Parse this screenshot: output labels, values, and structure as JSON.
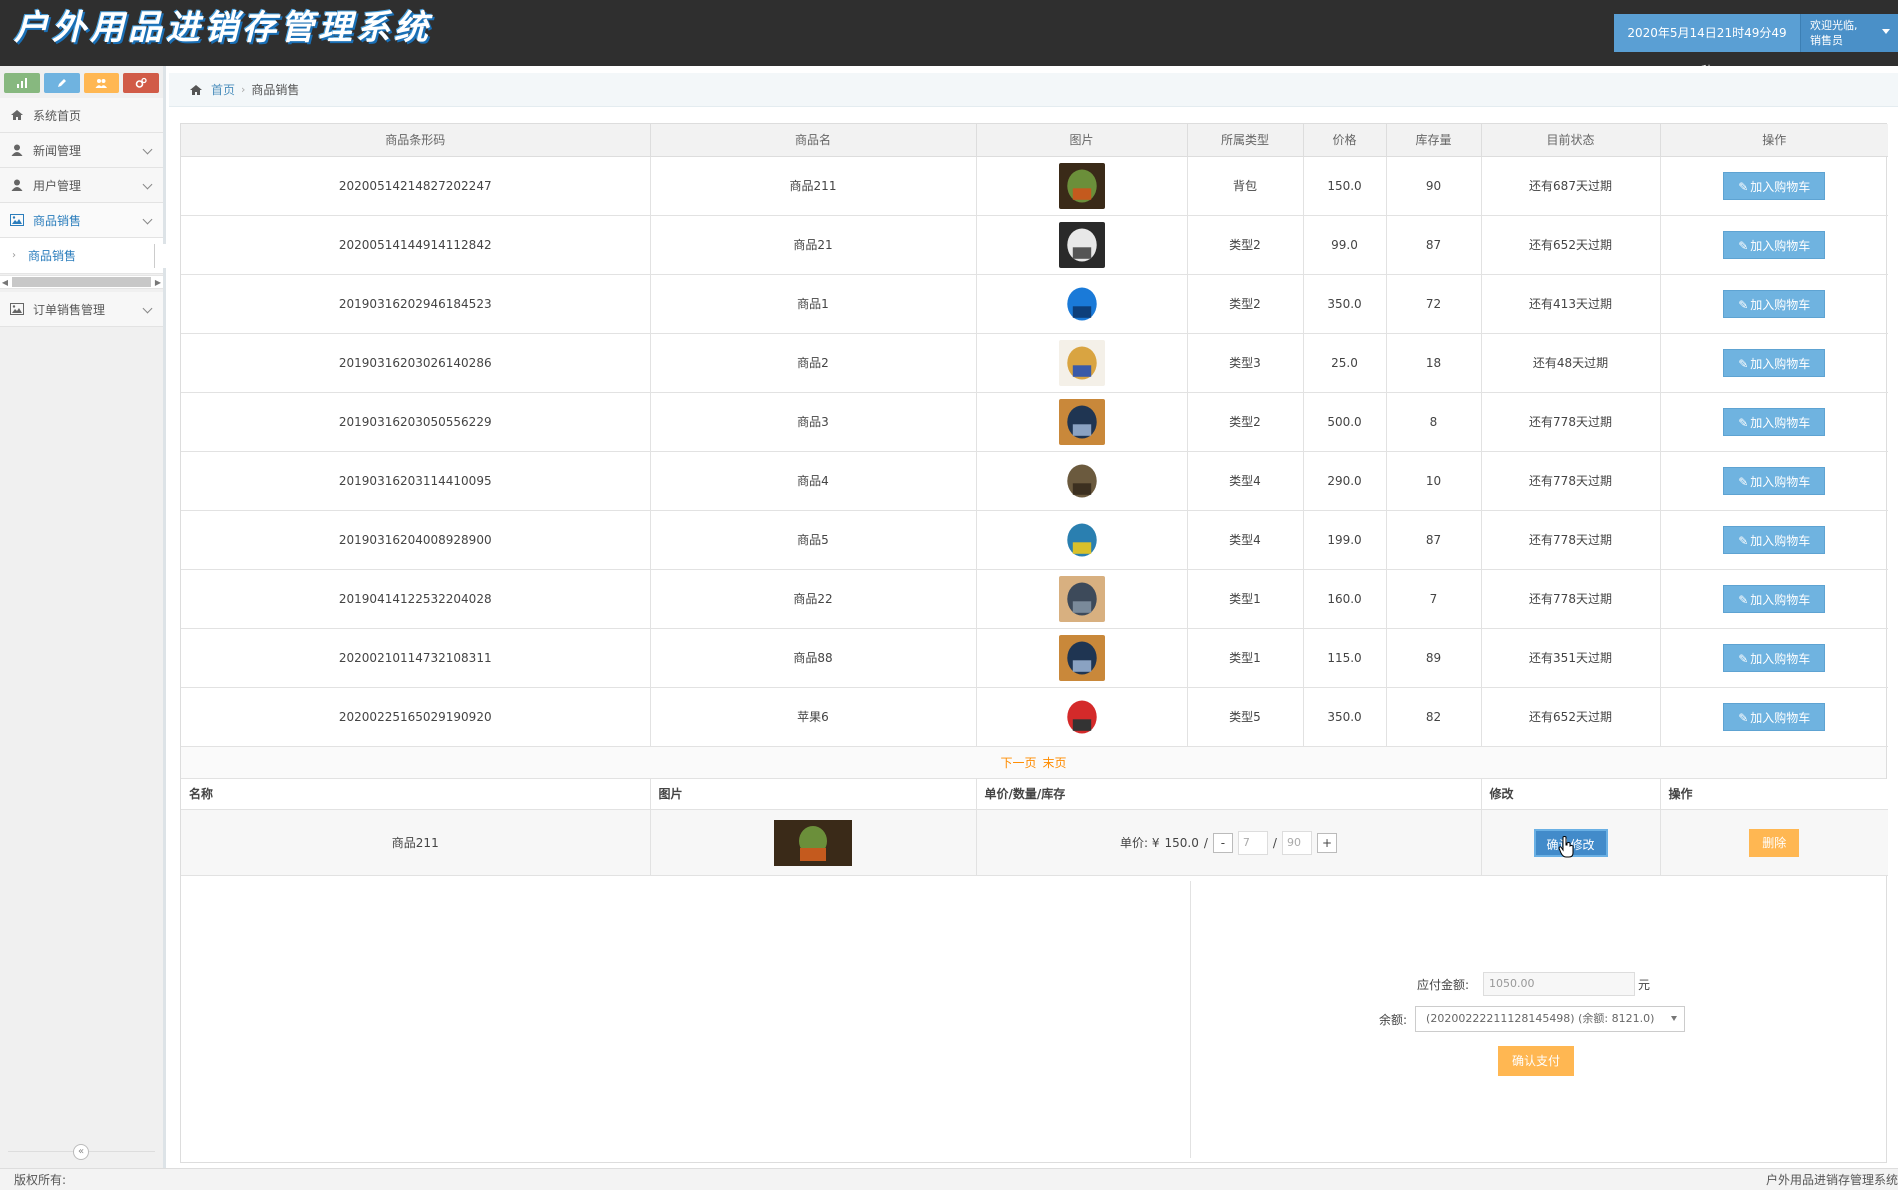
{
  "header": {
    "app_title": "户外用品进销存管理系统",
    "datetime": "2020年5月14日21时49分49秒",
    "welcome_line1": "欢迎光临,",
    "welcome_line2": "销售员"
  },
  "sidebar": {
    "shortcuts": [
      {
        "name": "chart-icon",
        "color": "#87b87f"
      },
      {
        "name": "pencil-icon",
        "color": "#6fb3e0"
      },
      {
        "name": "users-icon",
        "color": "#ffb752"
      },
      {
        "name": "cogs-icon",
        "color": "#d15b47"
      }
    ],
    "items": [
      {
        "label": "系统首页",
        "icon": "home-icon"
      },
      {
        "label": "新闻管理",
        "icon": "user-icon"
      },
      {
        "label": "用户管理",
        "icon": "user-icon"
      },
      {
        "label": "商品销售",
        "icon": "picture-icon"
      },
      {
        "label": "订单销售管理",
        "icon": "picture-icon"
      }
    ],
    "sub_item": "商品销售",
    "collapse_symbol": "«"
  },
  "breadcrumb": {
    "home": "首页",
    "current": "商品销售",
    "separator": "›"
  },
  "goods_table": {
    "headers": [
      "商品条形码",
      "商品名",
      "图片",
      "所属类型",
      "价格",
      "库存量",
      "目前状态",
      "操作"
    ],
    "action_label": "加入购物车",
    "rows": [
      {
        "barcode": "20200514214827202247",
        "name": "商品211",
        "type": "背包",
        "price": "150.0",
        "stock": "90",
        "status": "还有687天过期",
        "img": [
          "#3a2a18",
          "#6b8f3a",
          "#c45a1e"
        ]
      },
      {
        "barcode": "20200514144914112842",
        "name": "商品21",
        "type": "类型2",
        "price": "99.0",
        "stock": "87",
        "status": "还有652天过期",
        "img": [
          "#2a2a2a",
          "#e8e8e8",
          "#555555"
        ]
      },
      {
        "barcode": "20190316202946184523",
        "name": "商品1",
        "type": "类型2",
        "price": "350.0",
        "stock": "72",
        "status": "还有413天过期",
        "img": [
          "#ffffff",
          "#1a7ad8",
          "#0d3f7a"
        ]
      },
      {
        "barcode": "20190316203026140286",
        "name": "商品2",
        "type": "类型3",
        "price": "25.0",
        "stock": "18",
        "status": "还有48天过期",
        "img": [
          "#f4f0e8",
          "#d9a441",
          "#3a5aa8"
        ]
      },
      {
        "barcode": "20190316203050556229",
        "name": "商品3",
        "type": "类型2",
        "price": "500.0",
        "stock": "8",
        "status": "还有778天过期",
        "img": [
          "#c9883a",
          "#1f3552",
          "#8aa2c2"
        ]
      },
      {
        "barcode": "20190316203114410095",
        "name": "商品4",
        "type": "类型4",
        "price": "290.0",
        "stock": "10",
        "status": "还有778天过期",
        "img": [
          "#ffffff",
          "#6b5a3e",
          "#3c3020"
        ]
      },
      {
        "barcode": "20190316204008928900",
        "name": "商品5",
        "type": "类型4",
        "price": "199.0",
        "stock": "87",
        "status": "还有778天过期",
        "img": [
          "#ffffff",
          "#2a7fb0",
          "#d8c02a"
        ]
      },
      {
        "barcode": "20190414122532204028",
        "name": "商品22",
        "type": "类型1",
        "price": "160.0",
        "stock": "7",
        "status": "还有778天过期",
        "img": [
          "#d8b080",
          "#3d4a5a",
          "#7a8a9a"
        ]
      },
      {
        "barcode": "20200210114732108311",
        "name": "商品88",
        "type": "类型1",
        "price": "115.0",
        "stock": "89",
        "status": "还有351天过期",
        "img": [
          "#c9883a",
          "#1f3552",
          "#8aa2c2"
        ]
      },
      {
        "barcode": "20200225165029190920",
        "name": "苹果6",
        "type": "类型5",
        "price": "350.0",
        "stock": "82",
        "status": "还有652天过期",
        "img": [
          "#ffffff",
          "#d42a2a",
          "#333333"
        ]
      }
    ]
  },
  "pager": {
    "next": "下一页",
    "last": "末页"
  },
  "cart": {
    "headers": [
      "名称",
      "图片",
      "单价/数量/库存",
      "修改",
      "操作"
    ],
    "item_name": "商品211",
    "price_prefix": "单价: ¥",
    "price": "150.0",
    "slash": "/",
    "minus": "-",
    "plus": "+",
    "quantity": "7",
    "stock": "90",
    "confirm_edit": "确认修改",
    "delete": "删除",
    "img": [
      "#3a2a18",
      "#6b8f3a",
      "#c45a1e"
    ]
  },
  "payment": {
    "amount_label": "应付金额:",
    "amount_value": "1050.00",
    "unit": "元",
    "balance_label": "余额:",
    "balance_option": "(20200222211128145498) (余额: 8121.0)",
    "pay_button": "确认支付"
  },
  "footer": {
    "left": "版权所有:",
    "right": "户外用品进销存管理系统"
  }
}
